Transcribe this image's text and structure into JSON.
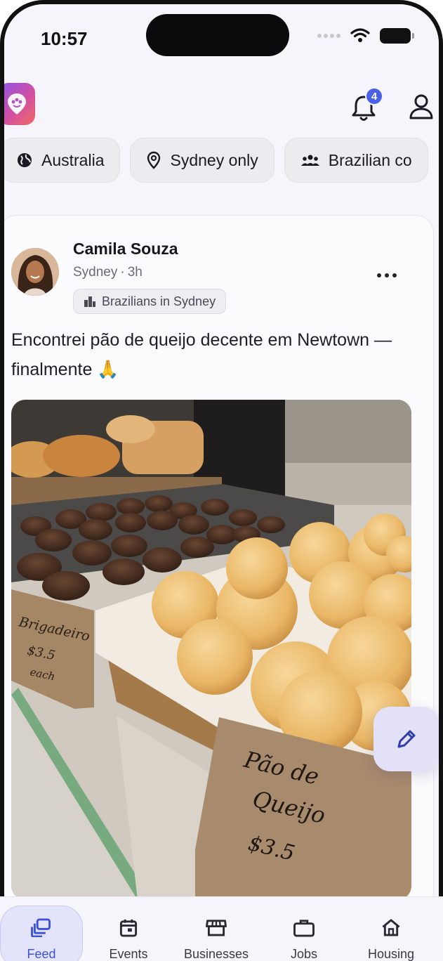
{
  "status_bar": {
    "time": "10:57"
  },
  "header": {
    "notification_count": "4"
  },
  "filters": [
    {
      "label": "Australia",
      "icon": "globe-icon"
    },
    {
      "label": "Sydney only",
      "icon": "location-pin-icon"
    },
    {
      "label": "Brazilian co",
      "icon": "community-icon"
    }
  ],
  "post": {
    "author": "Camila Souza",
    "location": "Sydney",
    "time": "3h",
    "separator": "·",
    "group": "Brazilians in Sydney",
    "text": "Encontrei pão de queijo decente em Newtown — finalmente 🙏",
    "image_signs": {
      "brigadeiro_name": "Brigadeiro",
      "brigadeiro_price": "$3.5",
      "brigadeiro_unit": "each",
      "pao_line1": "Pão de",
      "pao_line2": "Queijo",
      "pao_price": "$3.5"
    }
  },
  "nav": {
    "items": [
      {
        "label": "Feed",
        "icon": "feed-icon",
        "active": true
      },
      {
        "label": "Events",
        "icon": "calendar-icon",
        "active": false
      },
      {
        "label": "Businesses",
        "icon": "storefront-icon",
        "active": false
      },
      {
        "label": "Jobs",
        "icon": "briefcase-icon",
        "active": false
      },
      {
        "label": "Housing",
        "icon": "home-icon",
        "active": false
      }
    ]
  },
  "colors": {
    "accent": "#3d52d9",
    "badge": "#4a60e6",
    "fab_bg": "#e2e1f8"
  }
}
